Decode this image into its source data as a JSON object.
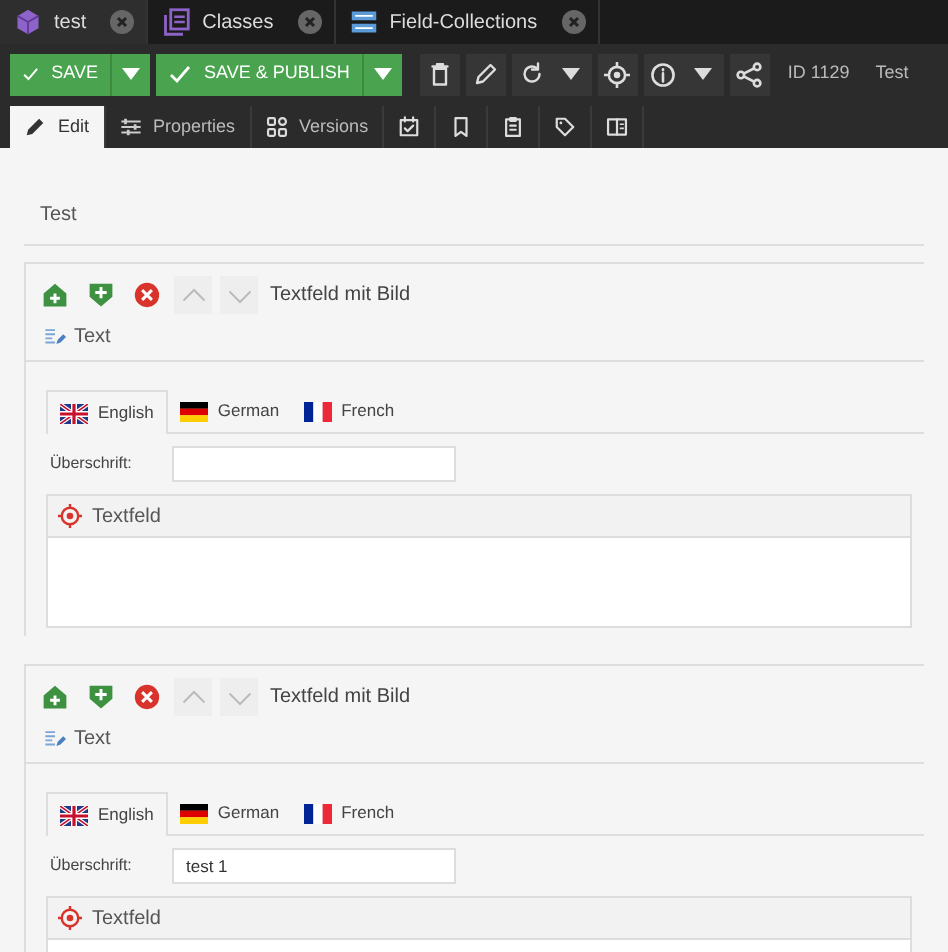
{
  "editor_tabs": [
    {
      "label": "test",
      "selected": true
    },
    {
      "label": "Classes",
      "selected": false
    },
    {
      "label": "Field-Collections",
      "selected": false
    }
  ],
  "toolbar": {
    "save": "SAVE",
    "save_publish": "SAVE & PUBLISH",
    "id": "ID 1129",
    "object": "Test"
  },
  "view_tabs": [
    {
      "label": "Edit",
      "selected": true
    },
    {
      "label": "Properties",
      "selected": false
    },
    {
      "label": "Versions",
      "selected": false
    },
    {
      "selected": false
    },
    {
      "selected": false
    },
    {
      "selected": false
    },
    {
      "selected": false
    },
    {
      "selected": false
    }
  ],
  "section_title": "Test",
  "blocks": [
    {
      "title": "Textfeld mit Bild",
      "type_label": "Text",
      "languages": [
        {
          "label": "English",
          "selected": true
        },
        {
          "label": "German",
          "selected": false
        },
        {
          "label": "French",
          "selected": false
        }
      ],
      "field_label": "Überschrift:",
      "editor_title": "Textfeld"
    },
    {
      "title": "Textfeld mit Bild",
      "type_label": "Text",
      "languages": [
        {
          "label": "English",
          "selected": true
        },
        {
          "label": "German",
          "selected": false
        },
        {
          "label": "French",
          "selected": false
        }
      ],
      "field_label": "Überschrift:",
      "field_value": "test 1",
      "editor_title": "Textfeld"
    }
  ]
}
